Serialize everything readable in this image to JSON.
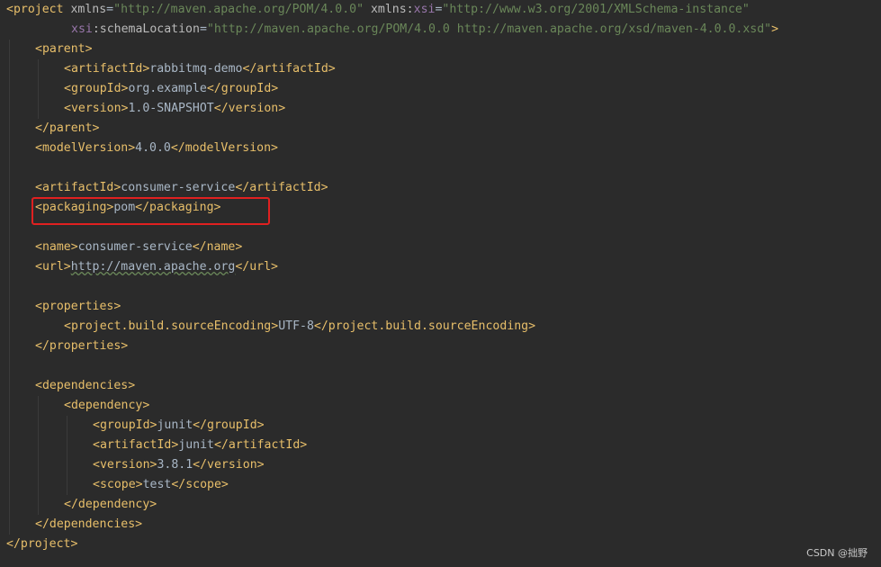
{
  "editor": {
    "lines": {
      "l1": {
        "t1": "<project ",
        "a1": "xmlns",
        "e1": "=",
        "v1": "\"http://maven.apache.org/POM/4.0.0\"",
        "sp": " ",
        "a2": "xmlns",
        "c": ":",
        "n1": "xsi",
        "e2": "=",
        "v2": "\"http://www.w3.org/2001/XMLSchema-instance\""
      },
      "l2": {
        "n1": "xsi",
        "c": ":",
        "a1": "schemaLocation",
        "e1": "=",
        "v1": "\"http://maven.apache.org/POM/4.0.0 http://maven.apache.org/xsd/maven-4.0.0.xsd\"",
        "t1": ">"
      },
      "l3": {
        "t1": "<parent>"
      },
      "l4": {
        "t1": "<artifactId>",
        "x": "rabbitmq-demo",
        "t2": "</artifactId>"
      },
      "l5": {
        "t1": "<groupId>",
        "x": "org.example",
        "t2": "</groupId>"
      },
      "l6": {
        "t1": "<version>",
        "x": "1.0-SNAPSHOT",
        "t2": "</version>"
      },
      "l7": {
        "t1": "</parent>"
      },
      "l8": {
        "t1": "<modelVersion>",
        "x": "4.0.0",
        "t2": "</modelVersion>"
      },
      "l9": {
        "t1": "<artifactId>",
        "x": "consumer-service",
        "t2": "</artifactId>"
      },
      "l10": {
        "t1": "<packaging>",
        "x": "pom",
        "t2": "</packaging>"
      },
      "l11": {
        "t1": "<name>",
        "x": "consumer-service",
        "t2": "</name>"
      },
      "l12": {
        "t1": "<url>",
        "x": "http://maven.apache.org",
        "t2": "</url>"
      },
      "l13": {
        "t1": "<properties>"
      },
      "l14": {
        "t1": "<project.build.sourceEncoding>",
        "x": "UTF-8",
        "t2": "</project.build.sourceEncoding>"
      },
      "l15": {
        "t1": "</properties>"
      },
      "l16": {
        "t1": "<dependencies>"
      },
      "l17": {
        "t1": "<dependency>"
      },
      "l18": {
        "t1": "<groupId>",
        "x": "junit",
        "t2": "</groupId>"
      },
      "l19": {
        "t1": "<artifactId>",
        "x": "junit",
        "t2": "</artifactId>"
      },
      "l20": {
        "t1": "<version>",
        "x": "3.8.1",
        "t2": "</version>"
      },
      "l21": {
        "t1": "<scope>",
        "x": "test",
        "t2": "</scope>"
      },
      "l22": {
        "t1": "</dependency>"
      },
      "l23": {
        "t1": "</dependencies>"
      },
      "l24": {
        "t1": "</project>"
      }
    }
  },
  "watermark": "CSDN @拙野",
  "colors": {
    "background": "#2b2b2b",
    "tag": "#e8bf6a",
    "attribute": "#bababa",
    "namespace": "#9876aa",
    "string": "#6a8759",
    "text": "#a9b7c6",
    "highlight_border": "#e02020"
  }
}
